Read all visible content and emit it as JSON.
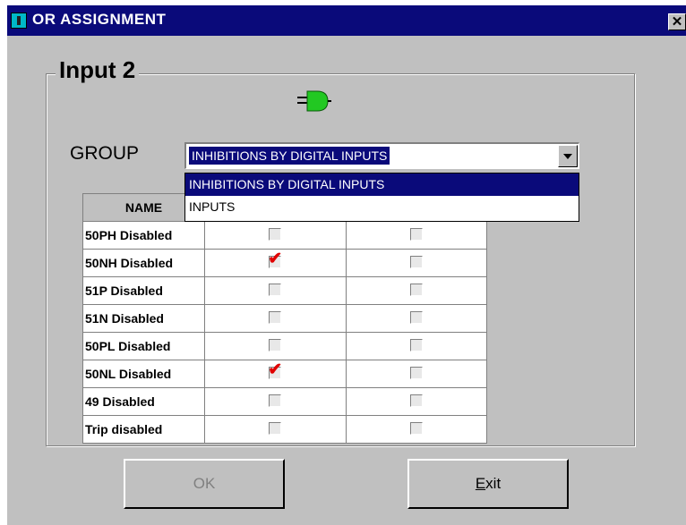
{
  "window": {
    "title": "OR ASSIGNMENT",
    "close_glyph": "✕"
  },
  "group_box": {
    "title": "Input 2",
    "icon": "plug-icon"
  },
  "group": {
    "label": "GROUP",
    "selected": "INHIBITIONS BY DIGITAL INPUTS",
    "options": [
      "INHIBITIONS BY DIGITAL INPUTS",
      "INPUTS"
    ]
  },
  "table": {
    "header": "NAME",
    "rows": [
      {
        "name": "50PH Disabled",
        "col1": false,
        "col2": false
      },
      {
        "name": "50NH Disabled",
        "col1": true,
        "col2": false
      },
      {
        "name": "51P Disabled",
        "col1": false,
        "col2": false
      },
      {
        "name": "51N Disabled",
        "col1": false,
        "col2": false
      },
      {
        "name": "50PL Disabled",
        "col1": false,
        "col2": false
      },
      {
        "name": "50NL Disabled",
        "col1": true,
        "col2": false
      },
      {
        "name": "49 Disabled",
        "col1": false,
        "col2": false
      },
      {
        "name": "Trip disabled",
        "col1": false,
        "col2": false
      }
    ]
  },
  "buttons": {
    "ok": "OK",
    "exit_mnemonic": "E",
    "exit_rest": "xit"
  },
  "colors": {
    "title_bar": "#0a0a7a",
    "face": "#c0c0c0",
    "check": "#e00000",
    "plug": "#22c822"
  }
}
